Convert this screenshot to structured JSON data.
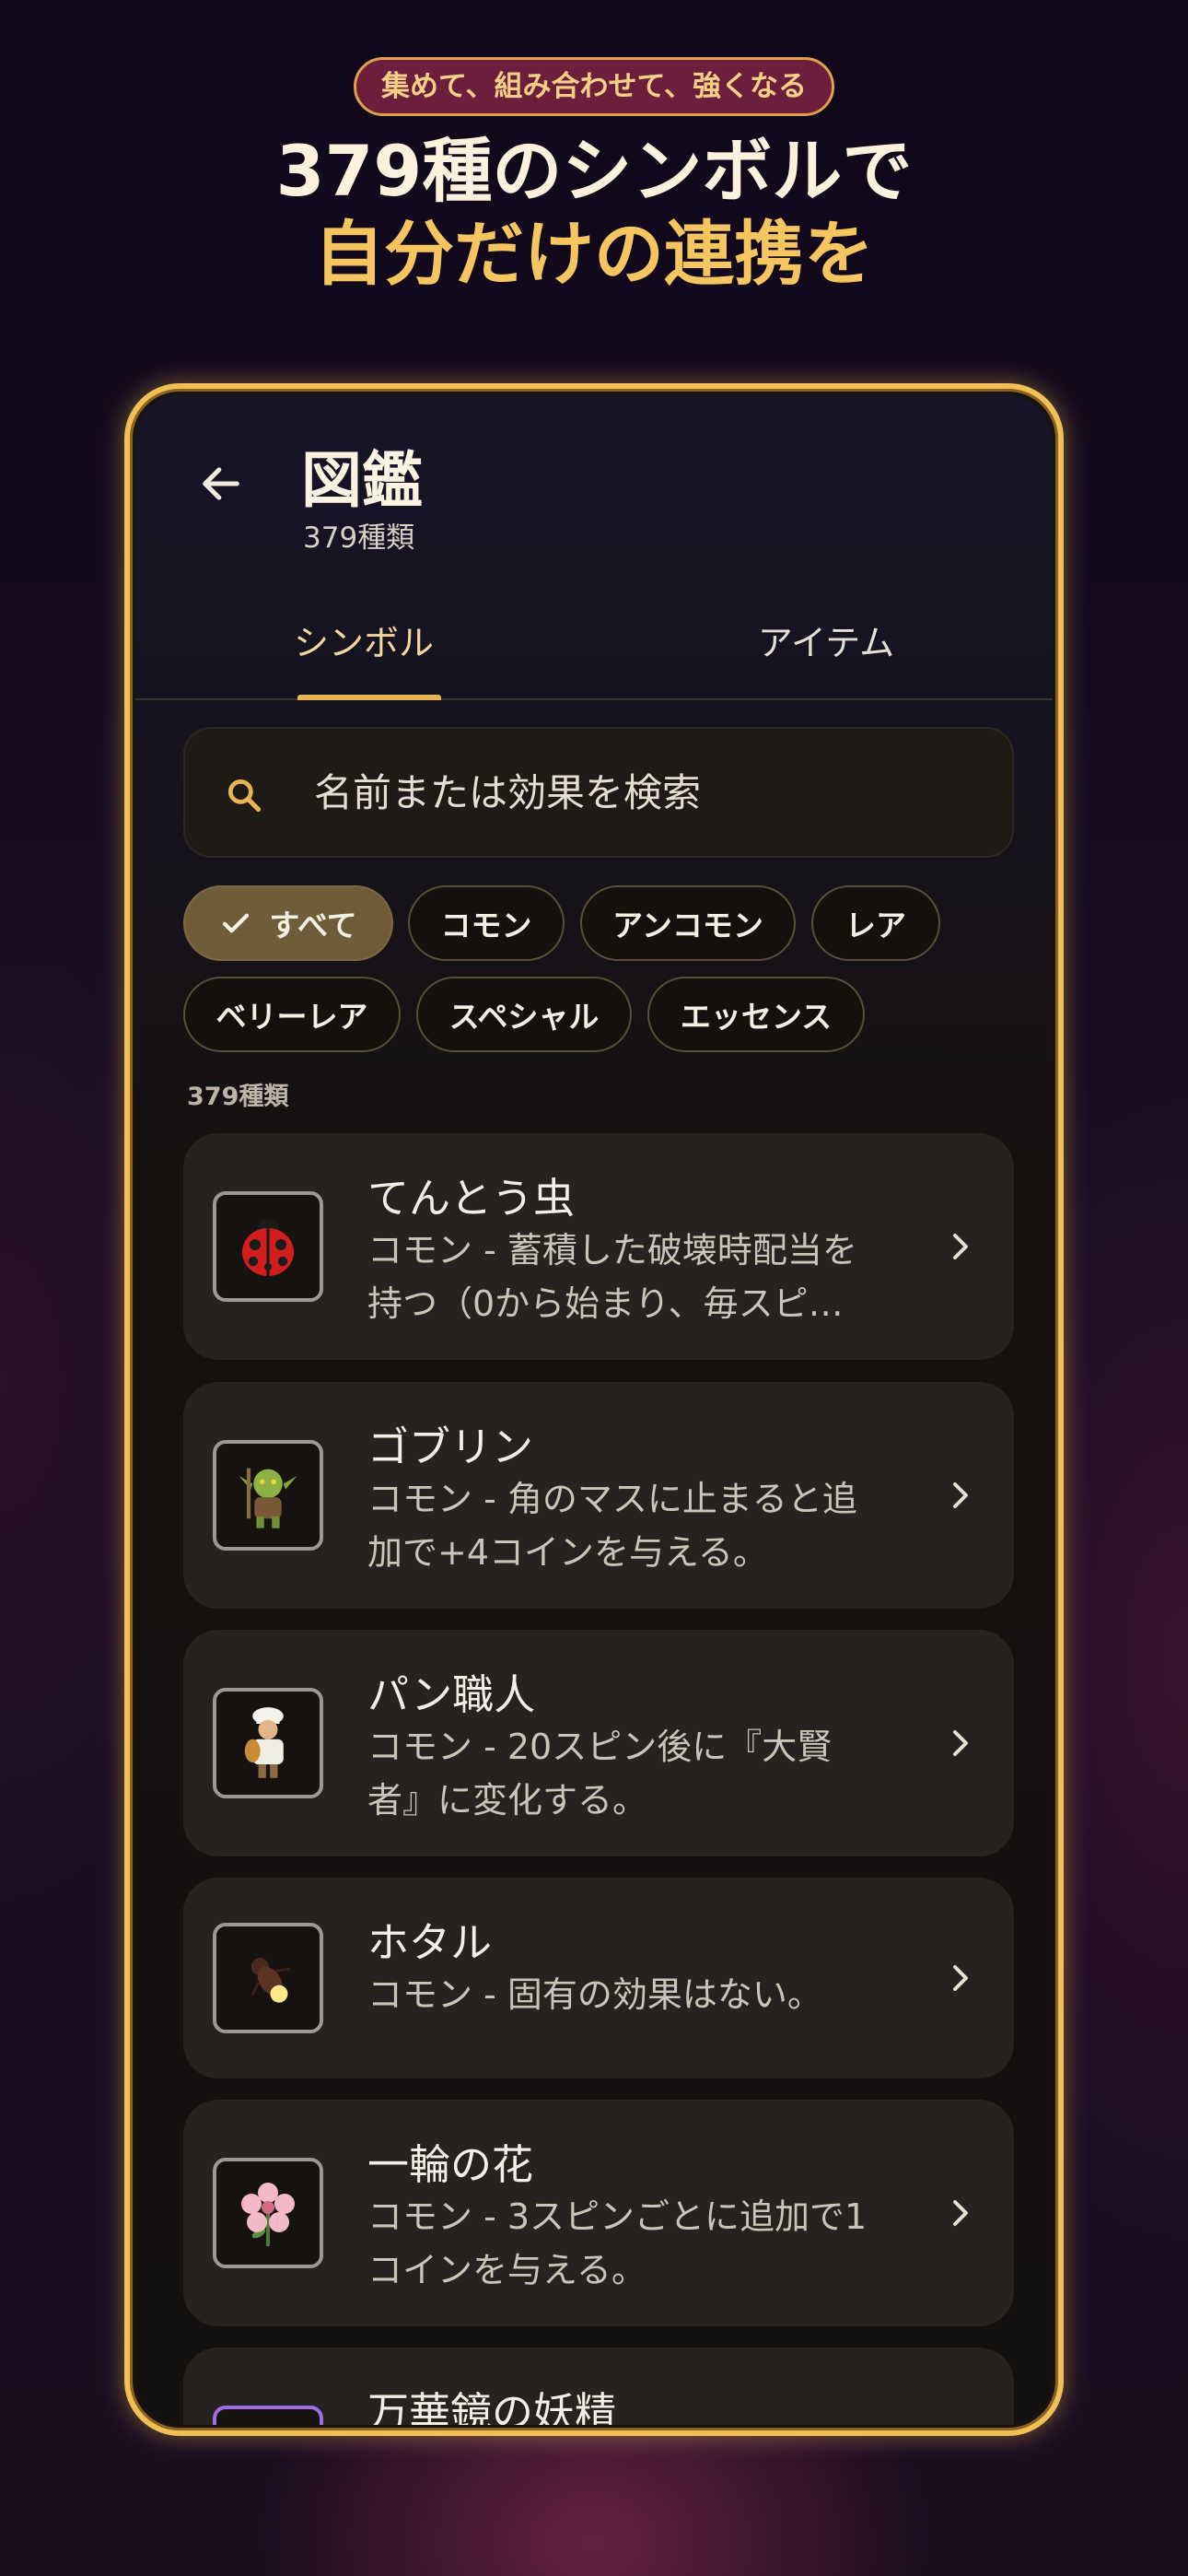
{
  "hero": {
    "badge": "集めて、組み合わせて、強くなる",
    "line1": "379種のシンボルで",
    "line2": "自分だけの連携を"
  },
  "app": {
    "title": "図鑑",
    "subtitle": "379種類",
    "tabs": [
      {
        "label": "シンボル",
        "selected": true
      },
      {
        "label": "アイテム",
        "selected": false
      }
    ],
    "search": {
      "placeholder": "名前または効果を検索",
      "value": ""
    },
    "filters": [
      {
        "label": "すべて",
        "selected": true
      },
      {
        "label": "コモン",
        "selected": false
      },
      {
        "label": "アンコモン",
        "selected": false
      },
      {
        "label": "レア",
        "selected": false
      },
      {
        "label": "ベリーレア",
        "selected": false
      },
      {
        "label": "スペシャル",
        "selected": false
      },
      {
        "label": "エッセンス",
        "selected": false
      }
    ],
    "result_count": "379種類",
    "symbols": [
      {
        "name": "てんとう虫",
        "desc_line1": "コモン - 蓄積した破壊時配当を",
        "desc_line2": "持つ（0から始まり、毎スピ…",
        "icon": "ladybug-icon"
      },
      {
        "name": "ゴブリン",
        "desc_line1": "コモン - 角のマスに止まると追",
        "desc_line2": "加で+4コインを与える。",
        "icon": "goblin-icon"
      },
      {
        "name": "パン職人",
        "desc_line1": "コモン - 20スピン後に『大賢",
        "desc_line2": "者』に変化する。",
        "icon": "baker-icon"
      },
      {
        "name": "ホタル",
        "desc_line1": "コモン - 固有の効果はない。",
        "desc_line2": "",
        "icon": "firefly-icon"
      },
      {
        "name": "一輪の花",
        "desc_line1": "コモン - 3スピンごとに追加で1",
        "desc_line2": "コインを与える。",
        "icon": "flower-icon"
      },
      {
        "name": "万華鏡の妖精",
        "desc_line1": "",
        "desc_line2": "",
        "icon": "fairy-icon"
      }
    ]
  },
  "colors": {
    "accent_gold": "#f0bf55",
    "tab_indicator": "#e7b552",
    "card_bg": "#25221f",
    "chip_active": "#6f5d3a"
  }
}
